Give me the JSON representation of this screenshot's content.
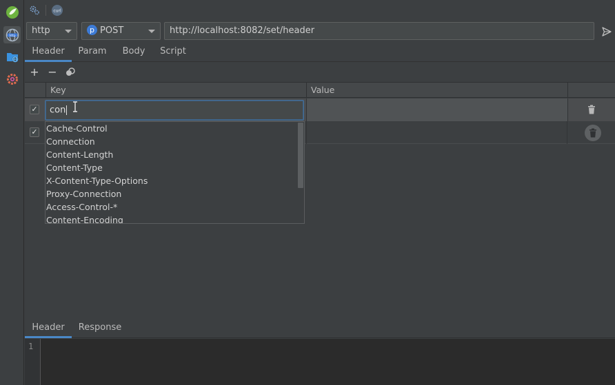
{
  "toolbar": {
    "settings_icon": "gear-icon",
    "curl_label": "curl"
  },
  "request": {
    "protocol": "http",
    "method_badge": "p",
    "method": "POST",
    "url": "http://localhost:8082/set/header"
  },
  "tabs": [
    {
      "label": "Header",
      "active": true
    },
    {
      "label": "Param",
      "active": false
    },
    {
      "label": "Body",
      "active": false
    },
    {
      "label": "Script",
      "active": false
    }
  ],
  "table": {
    "columns": {
      "key": "Key",
      "value": "Value"
    },
    "rows": [
      {
        "checked": true,
        "key": "con",
        "value": ""
      },
      {
        "checked": true,
        "key": "",
        "value": ""
      }
    ]
  },
  "autocomplete": {
    "items": [
      "Cache-Control",
      "Connection",
      "Content-Length",
      "Content-Type",
      "X-Content-Type-Options",
      "Proxy-Connection",
      "Access-Control-*",
      "Content-Encoding"
    ]
  },
  "response_tabs": [
    {
      "label": "Header",
      "active": true
    },
    {
      "label": "Response",
      "active": false
    }
  ],
  "editor": {
    "line_number": "1"
  },
  "colors": {
    "accent": "#4a88c7",
    "background": "#3c3f41",
    "editor_bg": "#2b2b2b"
  }
}
